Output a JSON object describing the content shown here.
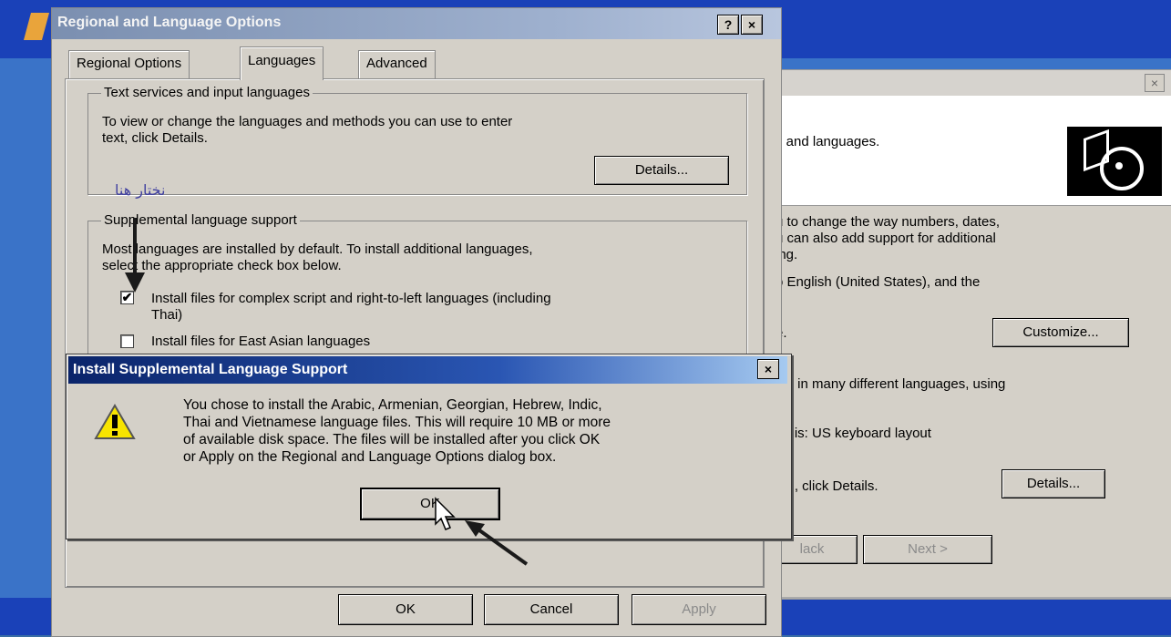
{
  "background_wizard": {
    "intro_text": "s and languages.",
    "para1_line1": "u to change the way numbers, dates,",
    "para1_line2": "u can also add support for additional",
    "para1_line3": "ing.",
    "para2": "o English (United States), and the",
    "para3": "e.",
    "customize_button": "Customize...",
    "para4": "ext in many different languages, using",
    "para5": "od is: US keyboard layout",
    "para6": "on , click Details.",
    "details_button": "Details...",
    "back_button": "Back",
    "back_button_visible": "lack",
    "next_button": "Next >"
  },
  "main_dialog": {
    "title": "Regional and Language Options",
    "help_button": "?",
    "close_button": "×",
    "tabs": [
      {
        "label": "Regional Options"
      },
      {
        "label": "Languages"
      },
      {
        "label": "Advanced"
      }
    ],
    "text_services": {
      "legend": "Text services and input languages",
      "line1": "To view or change the languages and methods you can use to enter",
      "line2": "text, click Details.",
      "details_button": "Details...",
      "annotation": "نختار هنا"
    },
    "supplemental": {
      "legend": "Supplemental language support",
      "line1": "Most languages are installed by default. To install additional languages,",
      "line2": "select the appropriate check box below.",
      "complex_script_line1": "Install files for complex script and right-to-left languages (including",
      "complex_script_line2": "Thai)",
      "complex_script_checked": true,
      "east_asian_label": "Install files for East Asian languages",
      "east_asian_checked": false
    },
    "ok_button": "OK",
    "cancel_button": "Cancel",
    "apply_button": "Apply"
  },
  "popup": {
    "title": "Install Supplemental Language Support",
    "close_button": "×",
    "message_line1": "You chose to install the Arabic, Armenian, Georgian, Hebrew, Indic,",
    "message_line2": "Thai and Vietnamese language files. This will require 10 MB or more",
    "message_line3": "of available disk space. The files will be installed after you click OK",
    "message_line4": "or Apply on the Regional and Language Options dialog box.",
    "ok_button": "OK",
    "icon": "warning-icon"
  }
}
